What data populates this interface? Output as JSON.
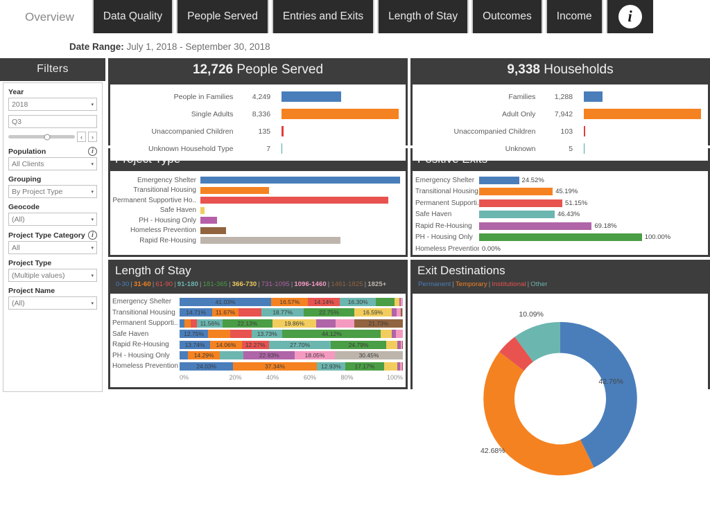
{
  "header": {
    "overview_label": "Overview",
    "tabs": [
      {
        "label": "Data Quality"
      },
      {
        "label": "People Served"
      },
      {
        "label": "Entries and Exits"
      },
      {
        "label": "Length of Stay"
      },
      {
        "label": "Outcomes"
      },
      {
        "label": "Income"
      }
    ],
    "info_icon": "info-icon",
    "info_glyph": "i"
  },
  "date_range": {
    "label": "Date Range:",
    "value": "July 1, 2018 -  September 30, 2018"
  },
  "filters": {
    "title": "Filters",
    "year": {
      "label": "Year",
      "value": "2018"
    },
    "quarter": {
      "value": "Q3"
    },
    "slider": {
      "prev": "‹",
      "next": "›",
      "position": 58
    },
    "population": {
      "label": "Population",
      "value": "All Clients",
      "info": "i"
    },
    "grouping": {
      "label": "Grouping",
      "value": "By Project Type"
    },
    "geocode": {
      "label": "Geocode",
      "value": "(All)"
    },
    "project_type_category": {
      "label": "Project Type Category",
      "value": "All",
      "info": "i"
    },
    "project_type": {
      "label": "Project Type",
      "value": "(Multiple values)"
    },
    "project_name": {
      "label": "Project Name",
      "value": "(All)"
    },
    "caret": "▾"
  },
  "people_served": {
    "title_count": "12,726",
    "title_rest": " People Served",
    "chart_data": {
      "type": "bar",
      "title": "12,726 People Served",
      "categories": [
        "People in Families",
        "Single Adults",
        "Unaccompanied Children",
        "Unknown Household Type"
      ],
      "values": [
        4249,
        8336,
        135,
        7
      ],
      "value_labels": [
        "4,249",
        "8,336",
        "135",
        "7"
      ],
      "colors": [
        "#4a7ebb",
        "#f58220",
        "#e03c3c",
        "#4aa8a0"
      ],
      "xlabel": "",
      "ylabel": "",
      "xlim": [
        0,
        8336
      ],
      "grid": false
    }
  },
  "households": {
    "title_count": "9,338",
    "title_rest": " Households",
    "chart_data": {
      "type": "bar",
      "title": "9,338 Households",
      "categories": [
        "Families",
        "Adult Only",
        "Unaccompanied Children",
        "Unknown"
      ],
      "values": [
        1288,
        7942,
        103,
        5
      ],
      "value_labels": [
        "1,288",
        "7,942",
        "103",
        "5"
      ],
      "colors": [
        "#4a7ebb",
        "#f58220",
        "#e03c3c",
        "#4aa8a0"
      ],
      "xlabel": "",
      "ylabel": "",
      "xlim": [
        0,
        7942
      ],
      "grid": false
    }
  },
  "project_type": {
    "title": "Project Type",
    "chart_data": {
      "type": "bar",
      "title": "Project Type",
      "categories": [
        "Emergency Shelter",
        "Transitional Housing",
        "Permanent Supportive Ho..",
        "Safe Haven",
        "PH - Housing Only",
        "Homeless Prevention",
        "Rapid Re-Housing"
      ],
      "values": [
        100,
        34.5,
        94,
        2.2,
        8.5,
        13,
        70
      ],
      "colors": [
        "#4a7ebb",
        "#f58220",
        "#e8534f",
        "#f2cd5d",
        "#b65fa8",
        "#91633f",
        "#bdb5ac"
      ],
      "xlabel": "",
      "ylabel": "",
      "grid": true
    }
  },
  "positive_exits": {
    "title": "Positive Exits",
    "chart_data": {
      "type": "bar",
      "title": "Positive Exits",
      "categories": [
        "Emergency Shelter",
        "Transitional Housing",
        "Permanent Supporti..",
        "Safe Haven",
        "Rapid Re-Housing",
        "PH - Housing Only",
        "Homeless Prevention"
      ],
      "values": [
        24.52,
        45.19,
        51.15,
        46.43,
        69.18,
        100.0,
        0.0
      ],
      "value_labels": [
        "24.52%",
        "45.19%",
        "51.15%",
        "46.43%",
        "69.18%",
        "100.00%",
        "0.00%"
      ],
      "colors": [
        "#4a7ebb",
        "#f58220",
        "#e8534f",
        "#6cb6b0",
        "#b065a8",
        "#4a9e45",
        "#ffffff"
      ],
      "xlabel": "",
      "ylabel": "",
      "xlim": [
        0,
        100
      ],
      "grid": true
    }
  },
  "length_of_stay": {
    "title": "Length of Stay",
    "legend": [
      {
        "label": "0-30",
        "color": "#4a7ebb"
      },
      {
        "label": "31-60",
        "color": "#f58220"
      },
      {
        "label": "61-90",
        "color": "#e8534f"
      },
      {
        "label": "91-180",
        "color": "#6cb6b0"
      },
      {
        "label": "181-365",
        "color": "#4a9e45"
      },
      {
        "label": "366-730",
        "color": "#f2cd5d"
      },
      {
        "label": "731-1095",
        "color": "#b065a8"
      },
      {
        "label": "1096-1460",
        "color": "#f49ac1"
      },
      {
        "label": "1461-1825",
        "color": "#91633f"
      },
      {
        "label": "1825+",
        "color": "#bdb5ac"
      }
    ],
    "separator": "|",
    "chart_data": {
      "type": "bar",
      "title": "Length of Stay",
      "stacked": true,
      "bins": [
        "0-30",
        "31-60",
        "61-90",
        "91-180",
        "181-365",
        "366-730",
        "731-1095",
        "1096-1460",
        "1461-1825",
        "1825+"
      ],
      "bin_colors": [
        "#4a7ebb",
        "#f58220",
        "#e8534f",
        "#6cb6b0",
        "#4a9e45",
        "#f2cd5d",
        "#b065a8",
        "#f49ac1",
        "#91633f",
        "#bdb5ac"
      ],
      "categories": [
        "Emergency Shelter",
        "Transitional Housing",
        "Permanent Supporti..",
        "Safe Haven",
        "Rapid Re-Housing",
        "PH - Housing Only",
        "Homeless Prevention"
      ],
      "series": [
        {
          "name": "Emergency Shelter",
          "values": [
            41.03,
            16.57,
            14.14,
            16.3,
            8.1,
            2.3,
            0.8,
            0.4,
            0.2,
            0.16
          ],
          "labels": [
            "41.03%",
            "16.57%",
            "14.14%",
            "16.30%",
            "",
            "",
            "",
            "",
            "",
            ""
          ]
        },
        {
          "name": "Transitional Housing",
          "values": [
            14.71,
            11.67,
            10.4,
            18.77,
            22.75,
            16.59,
            2.2,
            2.0,
            0.61,
            0.3
          ],
          "labels": [
            "14.71%",
            "11.67%",
            "",
            "18.77%",
            "22.75%",
            "16.59%",
            "",
            "",
            "",
            ""
          ]
        },
        {
          "name": "Permanent Supporti..",
          "values": [
            2.3,
            2.6,
            2.9,
            11.56,
            22.13,
            19.86,
            8.5,
            8.42,
            21.73,
            0.0
          ],
          "labels": [
            "",
            "",
            "",
            "11.56%",
            "22.13%",
            "19.86%",
            "",
            "",
            "21.73%",
            ""
          ]
        },
        {
          "name": "Safe Haven",
          "values": [
            12.75,
            9.8,
            9.8,
            13.73,
            44.12,
            4.9,
            1.96,
            2.94,
            0.0,
            0.0
          ],
          "labels": [
            "12.75%",
            "",
            "",
            "13.73%",
            "44.12%",
            "",
            "",
            "",
            "",
            ""
          ]
        },
        {
          "name": "Rapid Re-Housing",
          "values": [
            13.74,
            14.06,
            12.27,
            27.7,
            24.79,
            5.1,
            1.3,
            0.7,
            0.34,
            0.0
          ],
          "labels": [
            "13.74%",
            "14.06%",
            "12.27%",
            "27.70%",
            "24.79%",
            "",
            "",
            "",
            "",
            ""
          ]
        },
        {
          "name": "PH - Housing Only",
          "values": [
            3.8,
            14.29,
            0.0,
            10.66,
            0.0,
            0.0,
            22.93,
            18.05,
            0.0,
            30.45
          ],
          "labels": [
            "",
            "14.29%",
            "",
            "",
            "",
            "",
            "22.93%",
            "18.05%",
            "",
            "30.45%"
          ]
        },
        {
          "name": "Homeless Prevention",
          "values": [
            24.03,
            37.34,
            0.0,
            12.93,
            17.17,
            6.2,
            1.2,
            0.7,
            0.43,
            0.0
          ],
          "labels": [
            "24.03%",
            "37.34%",
            "",
            "12.93%",
            "17.17%",
            "",
            "",
            "",
            "",
            ""
          ]
        }
      ],
      "xticks": [
        "0%",
        "20%",
        "40%",
        "60%",
        "80%",
        "100%"
      ],
      "xlim": [
        0,
        100
      ],
      "grid": false
    }
  },
  "exit_destinations": {
    "title": "Exit Destinations",
    "legend": [
      {
        "label": "Permanent",
        "color": "#4a7ebb"
      },
      {
        "label": "Temporary",
        "color": "#f58220"
      },
      {
        "label": "Institutional",
        "color": "#e8534f"
      },
      {
        "label": "Other",
        "color": "#6cb6b0"
      }
    ],
    "separator": "|",
    "chart_data": {
      "type": "pie",
      "title": "Exit Destinations",
      "donut": true,
      "labels": [
        "Permanent",
        "Temporary",
        "Institutional",
        "Other"
      ],
      "values": [
        42.76,
        42.68,
        4.47,
        10.09
      ],
      "value_labels": [
        "42.76%",
        "42.68%",
        "",
        "10.09%"
      ],
      "colors": [
        "#4a7ebb",
        "#f58220",
        "#e8534f",
        "#6cb6b0"
      ]
    }
  }
}
